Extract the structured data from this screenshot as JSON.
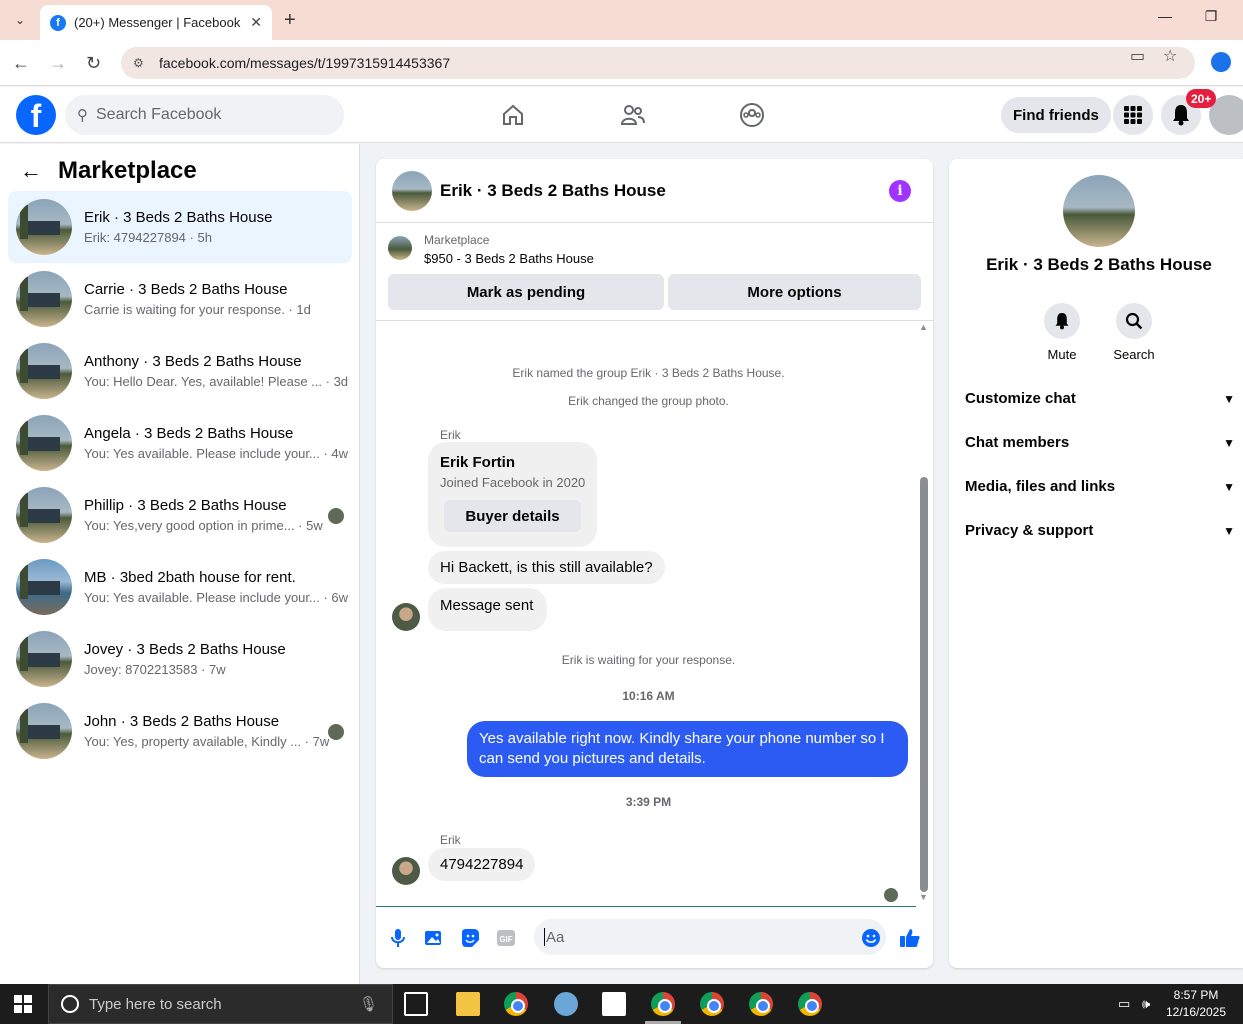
{
  "browser": {
    "tab_title": "(20+) Messenger | Facebook",
    "url": "facebook.com/messages/t/1997315914453367"
  },
  "fb_header": {
    "search_placeholder": "Search Facebook",
    "find_friends": "Find friends",
    "notification_badge": "20+"
  },
  "sidebar": {
    "title": "Marketplace",
    "conversations": [
      {
        "name": "Erik · 3 Beds 2 Baths House",
        "preview": "Erik: 4794227894 · 5h",
        "active": true
      },
      {
        "name": "Carrie · 3 Beds 2 Baths House",
        "preview": "Carrie is waiting for your response. · 1d"
      },
      {
        "name": "Anthony · 3 Beds 2 Baths House",
        "preview": "You: Hello Dear. Yes, available! Please ... · 3d"
      },
      {
        "name": "Angela · 3 Beds 2 Baths House",
        "preview": "You: Yes available. Please include your... · 4w"
      },
      {
        "name": "Phillip · 3 Beds 2 Baths House",
        "preview": "You: Yes,very good option in prime... · 5w"
      },
      {
        "name": "MB · 3bed 2bath house for rent.",
        "preview": "You: Yes available. Please include your... · 6w"
      },
      {
        "name": "Jovey · 3 Beds 2 Baths House",
        "preview": "Jovey: 8702213583 · 7w"
      },
      {
        "name": "John · 3 Beds 2 Baths House",
        "preview": "You: Yes, property available, Kindly ... · 7w"
      }
    ]
  },
  "chat": {
    "title": "Erik · 3 Beds 2 Baths House",
    "marketplace_label": "Marketplace",
    "listing": "$950 - 3 Beds 2 Baths House",
    "mark_pending": "Mark as pending",
    "more_options": "More options",
    "sys_named": "Erik named the group Erik · 3 Beds 2 Baths House.",
    "sys_photo": "Erik changed the group photo.",
    "sender1": "Erik",
    "card_name": "Erik Fortin",
    "card_sub": "Joined Facebook in 2020",
    "card_button": "Buyer details",
    "msg1": "Hi Backett, is this still available?",
    "msg2": "Message sent",
    "sys_waiting": "Erik is waiting for your response.",
    "time1": "10:16 AM",
    "my_msg": "Yes  available right now. Kindly share your phone number so I can send you pictures and details.",
    "time2": "3:39 PM",
    "sender2": "Erik",
    "msg3": "4794227894",
    "composer_placeholder": "Aa"
  },
  "right_panel": {
    "name": "Erik · 3 Beds 2 Baths House",
    "mute": "Mute",
    "search": "Search",
    "sections": [
      "Customize chat",
      "Chat members",
      "Media, files and links",
      "Privacy & support"
    ]
  },
  "taskbar": {
    "search_placeholder": "Type here to search",
    "time": "8:57 PM",
    "date": "12/16/2025"
  }
}
